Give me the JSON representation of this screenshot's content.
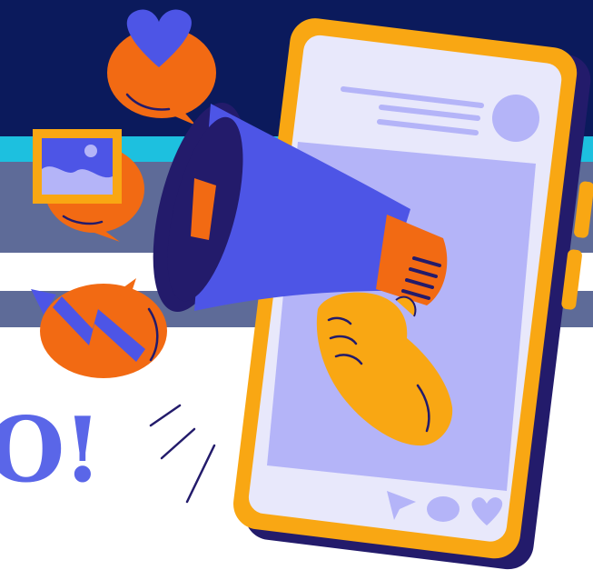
{
  "headline": {
    "text": "O!"
  },
  "colors": {
    "navy": "#0b1a5c",
    "cyan": "#1dc0df",
    "slate": "#5e6b98",
    "orange": "#f26a13",
    "yellow": "#f9a713",
    "blue": "#4d55e6",
    "lavender": "#b4b4f8",
    "screen": "#e8e8fb",
    "dark_purple": "#231b6b"
  },
  "icons": [
    "heart-chat-bubble-icon",
    "image-chat-bubble-icon",
    "trending-chat-bubble-icon",
    "megaphone-icon",
    "smartphone-icon",
    "send-icon",
    "comment-icon",
    "heart-icon"
  ]
}
